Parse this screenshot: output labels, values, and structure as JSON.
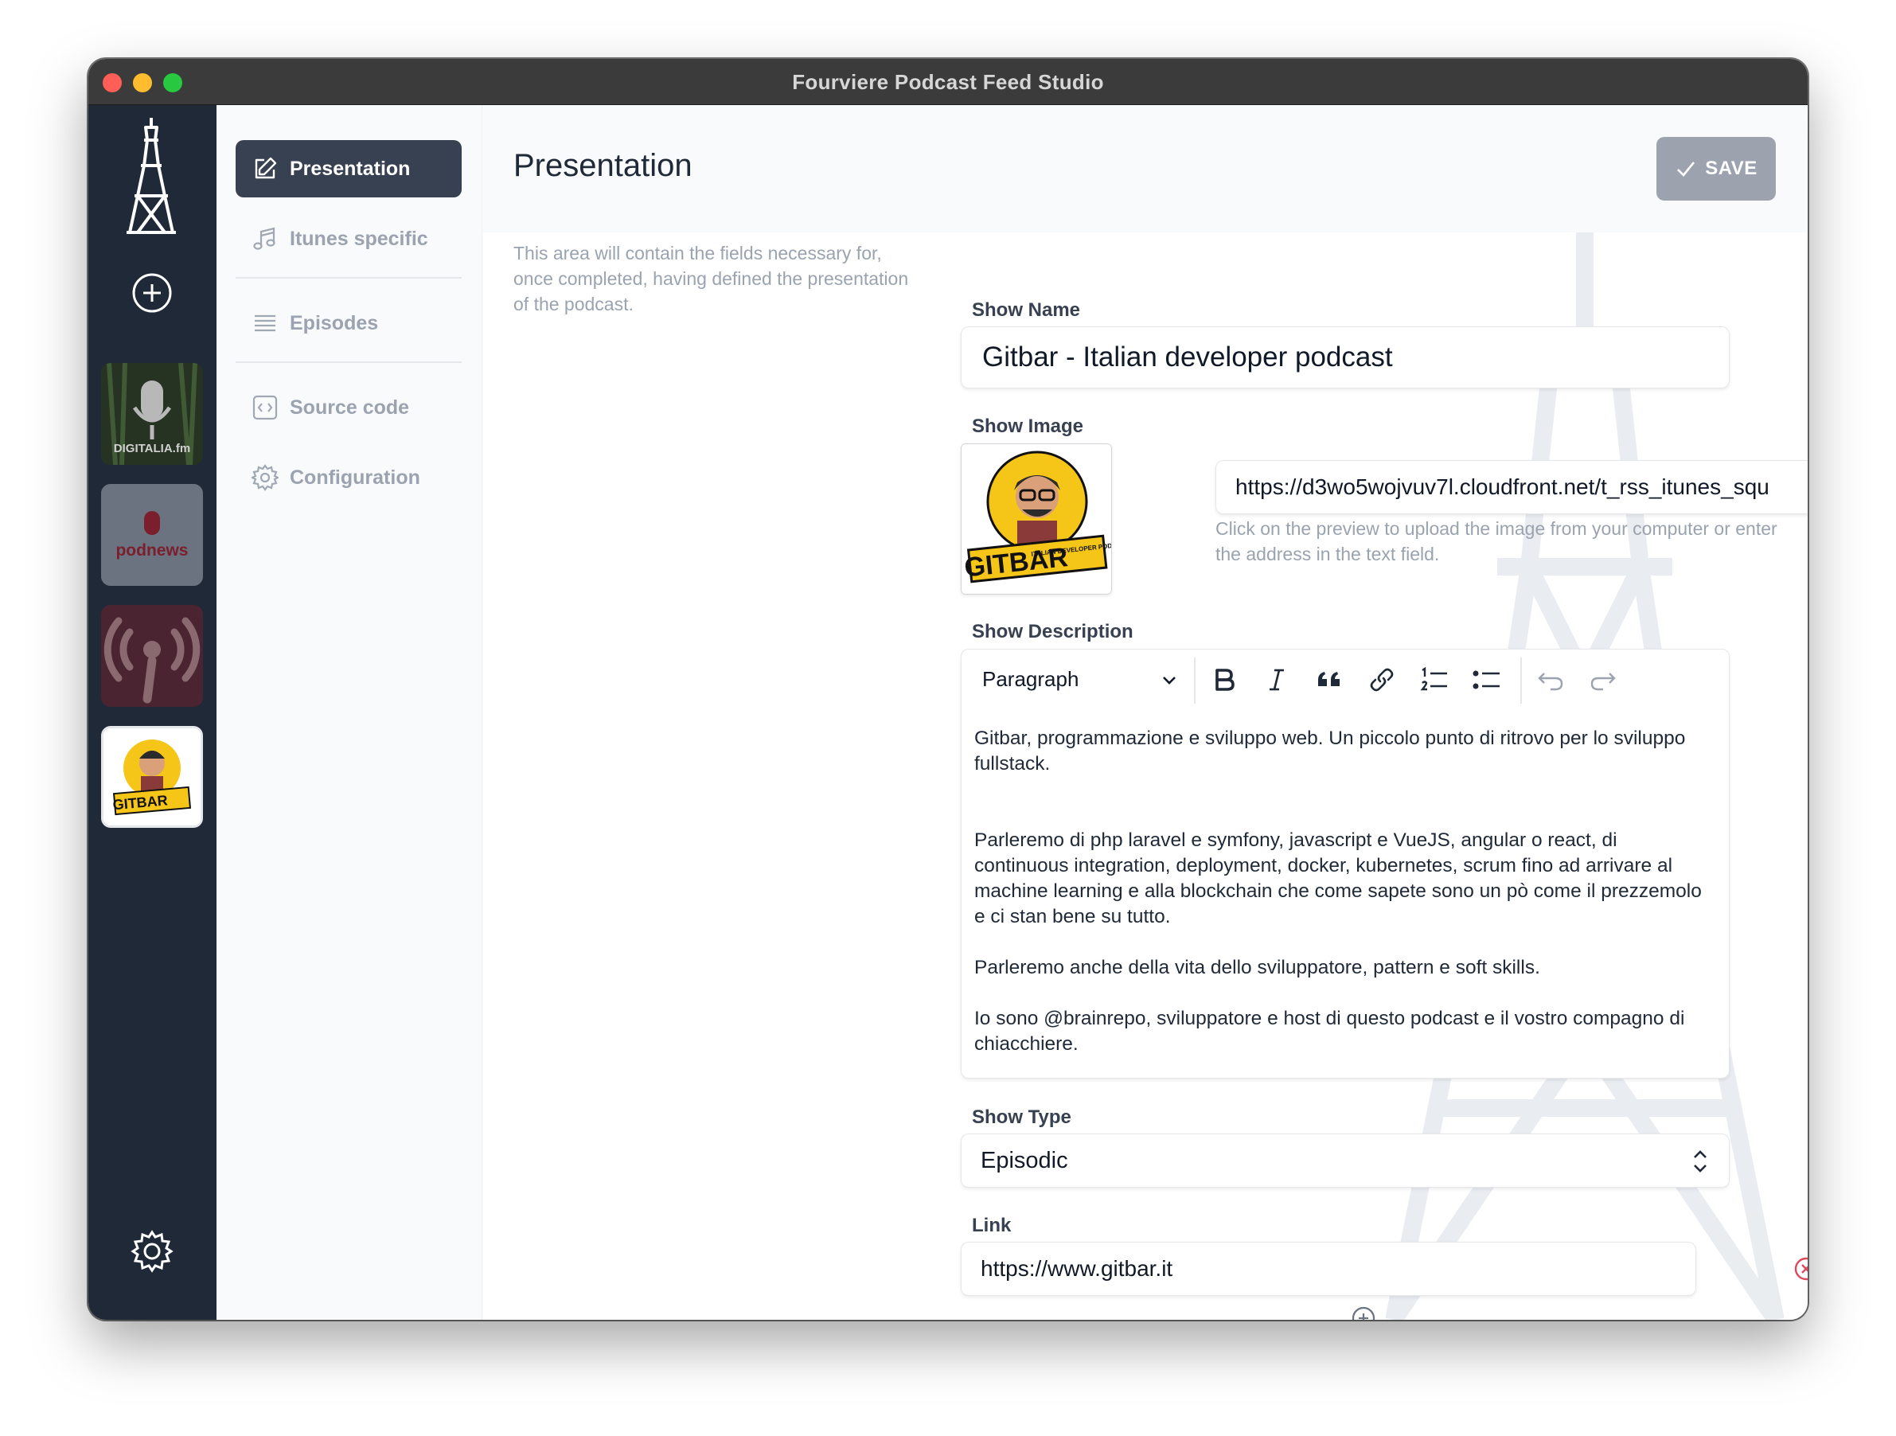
{
  "window": {
    "title": "Fourviere Podcast Feed Studio"
  },
  "nav": {
    "items": [
      {
        "label": "Presentation",
        "icon": "edit-icon",
        "active": true
      },
      {
        "label": "Itunes specific",
        "icon": "music-note-icon"
      },
      {
        "label": "Episodes",
        "icon": "list-icon"
      },
      {
        "label": "Source code",
        "icon": "code-icon"
      },
      {
        "label": "Configuration",
        "icon": "gear-icon"
      }
    ]
  },
  "rail": {
    "podcasts": [
      {
        "label": "DIGITALIA.fm"
      },
      {
        "label": "podnews"
      },
      {
        "label": "antenna"
      },
      {
        "label": "GITBAR"
      }
    ]
  },
  "header": {
    "title": "Presentation",
    "save_label": "SAVE"
  },
  "intro": "This area will contain the fields necessary for, once completed, having defined the presentation of the podcast.",
  "form": {
    "show_name": {
      "label": "Show Name",
      "value": "Gitbar - Italian developer podcast"
    },
    "show_image": {
      "label": "Show Image",
      "url": "https://d3wo5wojvuv7l.cloudfront.net/t_rss_itunes_squ",
      "hint": "Click on the preview to upload the image from your computer or enter the address in the text field.",
      "brand_text": "GITBAR",
      "brand_sub": "ITALIAN DEVELOPER PODCAST"
    },
    "show_description": {
      "label": "Show Description",
      "block_type": "Paragraph",
      "paragraphs": [
        "Gitbar, programmazione e sviluppo web. Un piccolo punto di ritrovo per lo sviluppo fullstack.",
        "Parleremo di php laravel e symfony, javascript e VueJS, angular o react, di continuous integration, deployment, docker, kubernetes, scrum fino ad arrivare al machine learning e alla blockchain che come sapete sono un pò come il prezzemolo e ci stan bene su tutto.",
        "Parleremo anche della vita dello sviluppatore, pattern e soft skills.",
        "Io sono @brainrepo, sviluppatore e host di questo podcast e il vostro compagno di chiacchiere."
      ]
    },
    "show_type": {
      "label": "Show Type",
      "value": "Episodic"
    },
    "link": {
      "label": "Link",
      "value": "https://www.gitbar.it"
    }
  },
  "colors": {
    "rail": "#1f2937",
    "active_nav": "#374151",
    "danger": "#e0475b",
    "save": "#9ca3af"
  }
}
